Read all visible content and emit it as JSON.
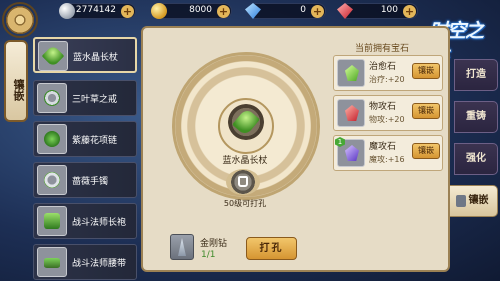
{
  "resources": [
    {
      "icon": "silver-coin-icon",
      "value": "2774142"
    },
    {
      "icon": "gold-coin-icon",
      "value": "8000"
    },
    {
      "icon": "blue-diamond-icon",
      "value": "0"
    },
    {
      "icon": "red-gem-icon",
      "value": "100"
    }
  ],
  "logo": {
    "text": "时空之塔"
  },
  "side_tab": {
    "label": "镶嵌"
  },
  "items": [
    {
      "name": "蓝水晶长杖"
    },
    {
      "name": "三叶草之戒"
    },
    {
      "name": "紫藤花项链"
    },
    {
      "name": "蔷薇手镯"
    },
    {
      "name": "战斗法师长袍"
    },
    {
      "name": "战斗法师腰带"
    }
  ],
  "center": {
    "item_name": "蓝水晶长杖",
    "lock_label": "50级可打孔"
  },
  "drill": {
    "name": "金刚钻",
    "count": "1/1",
    "button_label": "打孔"
  },
  "gems": {
    "title": "当前拥有宝石",
    "list": [
      {
        "name": "治愈石",
        "stat": "治疗:+20",
        "button": "镶嵌",
        "color": "#6fcf3a"
      },
      {
        "name": "物攻石",
        "stat": "物攻:+20",
        "button": "镶嵌",
        "color": "#d23a3a"
      },
      {
        "name": "魔攻石",
        "stat": "魔攻:+16",
        "button": "镶嵌",
        "color": "#7a52d8",
        "badge": "1"
      }
    ]
  },
  "right_tabs": [
    {
      "label": "打造"
    },
    {
      "label": "重铸"
    },
    {
      "label": "强化"
    },
    {
      "label": "镶嵌",
      "active": true
    }
  ]
}
